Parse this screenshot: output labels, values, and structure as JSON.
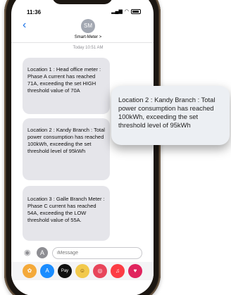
{
  "status_bar": {
    "time": "11:36",
    "signal": "▂▄▆",
    "wifi": "◠"
  },
  "header": {
    "back": "‹",
    "avatar_initials": "SM",
    "contact_name": "Smart-Meter >"
  },
  "thread": {
    "timestamp": "Today 10:51 AM"
  },
  "messages": [
    {
      "text": "Location 1 : Head office meter : Phase A current has reached 71A, exceeding the set HIGH threshold value of 70A"
    },
    {
      "text": "Location 2 : Kandy Branch : Total power consumption has reached 100kWh, exceeding the set threshold level of 95kWh"
    },
    {
      "text": "Location 3 : Galle Branch Meter : Phase C current has reached 54A, exceeding the LOW threshold value of 55A."
    }
  ],
  "compose": {
    "placeholder": "iMessage"
  },
  "app_strip": [
    {
      "name": "photos-app-icon",
      "glyph": "✿",
      "color": "#f4a93a"
    },
    {
      "name": "app-store-icon",
      "glyph": "A",
      "color": "#1a8cff"
    },
    {
      "name": "apple-pay-icon",
      "glyph": "Pay",
      "color": "#111111"
    },
    {
      "name": "memoji-icon",
      "glyph": "☺",
      "color": "#f2c94c"
    },
    {
      "name": "search-images-icon",
      "glyph": "◎",
      "color": "#e8455a"
    },
    {
      "name": "music-icon",
      "glyph": "♫",
      "color": "#fc3c44"
    },
    {
      "name": "heart-sticker-icon",
      "glyph": "♥",
      "color": "#e0245e"
    }
  ],
  "popout": {
    "text": "Location 2 : Kandy Branch : Total power consumption has reached 100kWh, exceeding the set threshold level of 95kWh"
  }
}
